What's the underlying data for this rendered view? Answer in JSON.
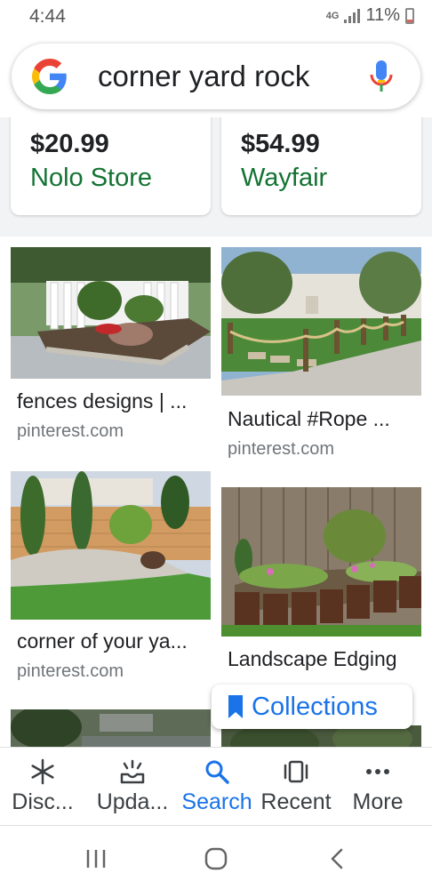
{
  "status_bar": {
    "time": "4:44",
    "network": "4G",
    "battery": "11%"
  },
  "search": {
    "query": "corner yard rock"
  },
  "products": [
    {
      "price": "$20.99",
      "store": "Nolo Store"
    },
    {
      "price": "$54.99",
      "store": "Wayfair"
    }
  ],
  "images": [
    {
      "title": "fences designs | ...",
      "source": "pinterest.com"
    },
    {
      "title": "Nautical #Rope ...",
      "source": "pinterest.com"
    },
    {
      "title": "corner of your ya...",
      "source": "pinterest.com"
    },
    {
      "title": "Landscape Edging",
      "source": ""
    }
  ],
  "collections": {
    "label": "Collections"
  },
  "bottom_nav": {
    "items": [
      {
        "label": "Disc...",
        "icon": "asterisk-icon"
      },
      {
        "label": "Upda...",
        "icon": "updates-icon"
      },
      {
        "label": "Search",
        "icon": "search-icon",
        "active": true
      },
      {
        "label": "Recent",
        "icon": "recent-icon"
      },
      {
        "label": "More",
        "icon": "more-dots-icon"
      }
    ]
  },
  "colors": {
    "accent": "#1a73e8",
    "store_green": "#137333",
    "text": "#202124",
    "source_gray": "#70757a"
  }
}
